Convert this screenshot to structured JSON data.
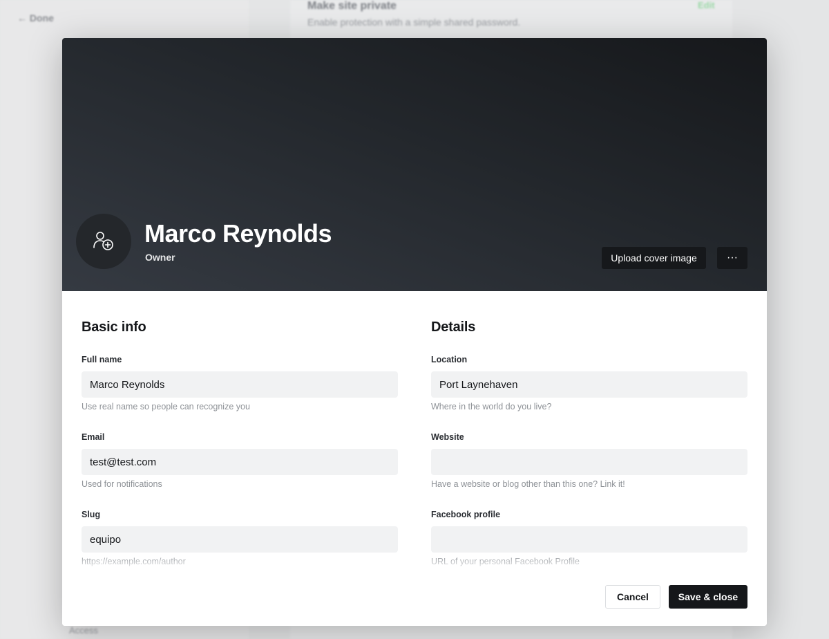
{
  "background": {
    "back_label": "← Done",
    "setting_title": "Make site private",
    "setting_description": "Enable protection with a simple shared password.",
    "setting_action": "Edit",
    "sidebar_item": "Access"
  },
  "profile": {
    "name": "Marco Reynolds",
    "role": "Owner",
    "upload_cover_label": "Upload cover image",
    "more_label": "···"
  },
  "basic_info": {
    "title": "Basic info",
    "fields": [
      {
        "label": "Full name",
        "value": "Marco Reynolds",
        "placeholder": "",
        "hint": "Use real name so people can recognize you"
      },
      {
        "label": "Email",
        "value": "test@test.com",
        "placeholder": "",
        "hint": "Used for notifications"
      },
      {
        "label": "Slug",
        "value": "equipo",
        "placeholder": "",
        "hint": "https://example.com/author"
      }
    ]
  },
  "details": {
    "title": "Details",
    "fields": [
      {
        "label": "Location",
        "value": "Port Laynehaven",
        "placeholder": "",
        "hint": "Where in the world do you live?"
      },
      {
        "label": "Website",
        "value": "",
        "placeholder": "",
        "hint": "Have a website or blog other than this one? Link it!"
      },
      {
        "label": "Facebook profile",
        "value": "",
        "placeholder": "",
        "hint": "URL of your personal Facebook Profile"
      }
    ]
  },
  "footer": {
    "cancel_label": "Cancel",
    "save_label": "Save & close"
  },
  "colors": {
    "primary_button": "#15171a",
    "input_background": "#f1f2f3",
    "edit_accent": "#30cf43"
  }
}
